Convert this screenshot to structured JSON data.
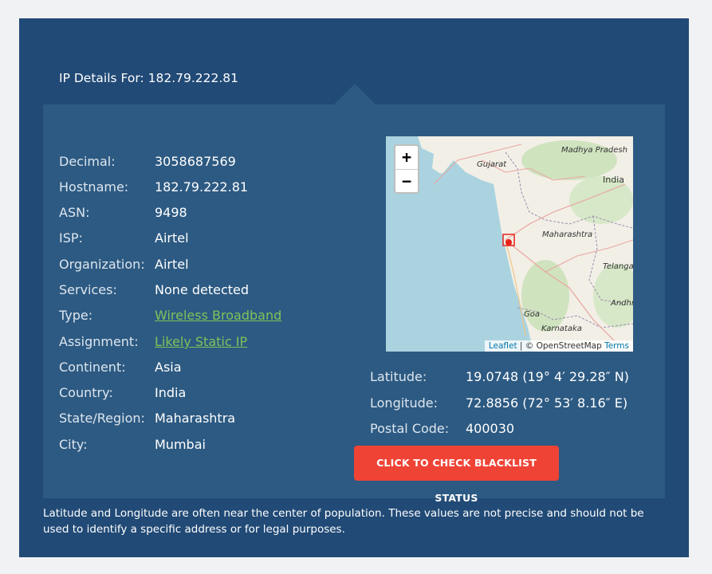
{
  "heading": {
    "label": "IP Details For:",
    "ip": "182.79.222.81"
  },
  "details": [
    {
      "label": "Decimal:",
      "value": "3058687569"
    },
    {
      "label": "Hostname:",
      "value": "182.79.222.81"
    },
    {
      "label": "ASN:",
      "value": "9498"
    },
    {
      "label": "ISP:",
      "value": "Airtel"
    },
    {
      "label": "Organization:",
      "value": "Airtel"
    },
    {
      "label": "Services:",
      "value": "None detected"
    },
    {
      "label": "Type:",
      "value": "Wireless Broadband"
    },
    {
      "label": "Assignment:",
      "value": "Likely Static IP"
    },
    {
      "label": "Continent:",
      "value": "Asia"
    },
    {
      "label": "Country:",
      "value": "India"
    },
    {
      "label": "State/Region:",
      "value": "Maharashtra"
    },
    {
      "label": "City:",
      "value": "Mumbai"
    }
  ],
  "geo": [
    {
      "label": "Latitude:",
      "value": "19.0748  (19° 4′ 29.28″ N)"
    },
    {
      "label": "Longitude:",
      "value": "72.8856  (72° 53′ 8.16″ E)"
    },
    {
      "label": "Postal Code:",
      "value": "400030"
    }
  ],
  "map": {
    "zoom_in": "+",
    "zoom_out": "−",
    "labels": {
      "madhya_pradesh": "Madhya Pradesh",
      "gujarat": "Gujarat",
      "india": "India",
      "maharashtra": "Maharashtra",
      "telangana": "Telanga",
      "andhra": "Andhr",
      "goa": "Goa",
      "karnataka": "Karnataka"
    },
    "attribution": {
      "leaflet": "Leaflet",
      "separator": " | © OpenStreetMap ",
      "terms": "Terms"
    },
    "colors": {
      "sea": "#aad3df",
      "land": "#f2efe6",
      "forest": "#cfe3bf",
      "marker": "#e8221b"
    }
  },
  "button": {
    "label": "CLICK TO CHECK BLACKLIST STATUS",
    "color": "#ef4335"
  },
  "note": "Latitude and Longitude are often near the center of population. These values are not precise and should not be used to identify a specific address or for legal purposes.",
  "colors": {
    "background": "#214a76",
    "panel": "#2d5a82",
    "link": "#7cc35a"
  }
}
